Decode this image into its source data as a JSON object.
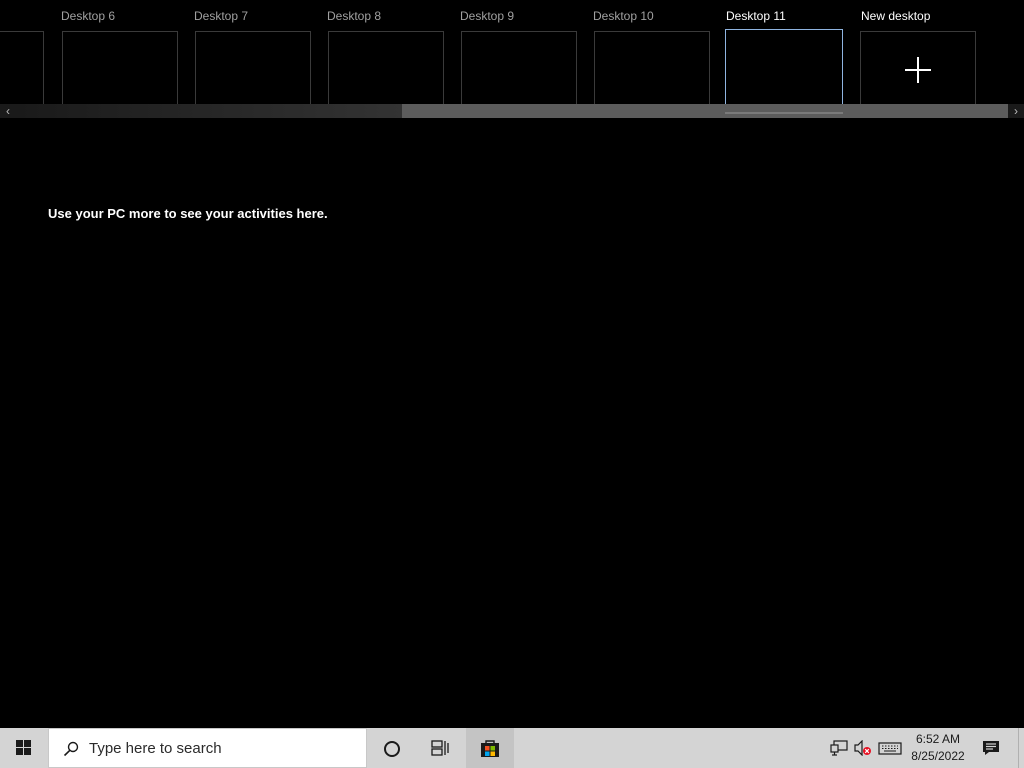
{
  "desktops": [
    {
      "label": ""
    },
    {
      "label": "Desktop 6"
    },
    {
      "label": "Desktop 7"
    },
    {
      "label": "Desktop 8"
    },
    {
      "label": "Desktop 9"
    },
    {
      "label": "Desktop 10"
    },
    {
      "label": "Desktop 11",
      "current": true
    }
  ],
  "new_desktop_label": "New desktop",
  "activities_message": "Use your PC more to see your activities here.",
  "taskbar": {
    "search_placeholder": "Type here to search",
    "time": "6:52 AM",
    "date": "8/25/2022"
  },
  "colors": {
    "background": "#000000",
    "taskbar": "#d4d4d4",
    "current_desktop_border": "#8fb4e0"
  },
  "icons": {
    "start": "windows-logo-icon",
    "search": "search-icon",
    "cortana": "cortana-icon",
    "task_view": "task-view-icon",
    "store": "microsoft-store-icon",
    "network": "network-icon",
    "volume": "volume-muted-icon",
    "keyboard": "keyboard-icon",
    "notifications": "action-center-icon"
  }
}
